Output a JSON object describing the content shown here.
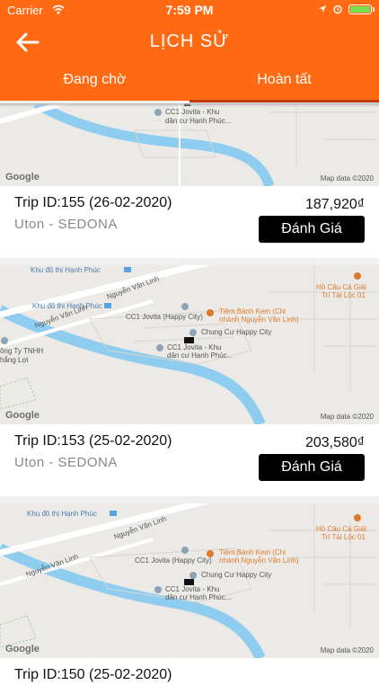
{
  "status": {
    "carrier": "Carrier",
    "time": "7:59 PM"
  },
  "header": {
    "title": "LỊCH SỬ"
  },
  "tabs": [
    {
      "label": "Đang chờ"
    },
    {
      "label": "Hoàn tất"
    }
  ],
  "map": {
    "google": "Google",
    "map_data": "Map data ©2020",
    "labels": {
      "khu_do_thi": "Khu đô thị Hạnh Phúc",
      "nguyen_van_linh": "Nguyễn Văn Linh",
      "jovita_happy": "CC1 Jovita (Happy City)",
      "chung_cu": "Chung Cư Happy City",
      "jovita_khu_1": "CC1 Jovita - Khu",
      "jovita_khu_2": "dân cư Hạnh Phúc...",
      "tiem_banh_1": "Tiệm Bánh Kem (Chi",
      "tiem_banh_2": "nhánh Nguyễn Văn Linh)",
      "ho_cau_1": "Hồ Câu Cá Giải",
      "ho_cau_2": "Trí Tài Lộc 01",
      "cong_ty_1": "ông Ty TNHH",
      "cong_ty_2": "hắng Lợi"
    }
  },
  "trips": [
    {
      "trip_id": "Trip ID:155 (26-02-2020)",
      "vehicle": "Uton - SEDONA",
      "price": "187,920₫",
      "button": "Đánh Giá"
    },
    {
      "trip_id": "Trip ID:153 (25-02-2020)",
      "vehicle": "Uton - SEDONA",
      "price": "203,580₫",
      "button": "Đánh Giá"
    },
    {
      "trip_id": "Trip ID:150 (25-02-2020)"
    }
  ]
}
